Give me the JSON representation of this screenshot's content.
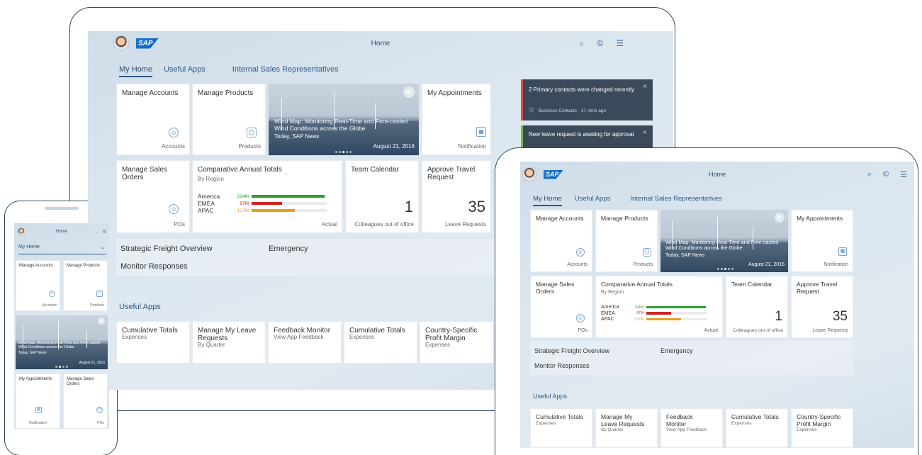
{
  "desktop": {
    "shell": {
      "title": "Home",
      "logo": "SAP",
      "icons": [
        "search-icon",
        "copilot-icon",
        "notifications-icon"
      ]
    },
    "tabs": [
      "My Home",
      "Useful Apps",
      "Internal Sales Representatives"
    ],
    "tiles": {
      "manage_accounts": {
        "title": "Manage Accounts",
        "icon": "accounts-icon",
        "footer": "Accounts"
      },
      "manage_products": {
        "title": "Manage Products",
        "icon": "products-icon",
        "footer": "Products"
      },
      "news": {
        "text": "Wind Map: Monitoring Real-Time and Fore-casted Wind Conditions across the Globe",
        "source": "Today, SAP News",
        "date": "August 21, 2016"
      },
      "my_appointments": {
        "title": "My Appointments",
        "icon": "calendar-icon",
        "footer": "Notification"
      },
      "manage_sales_orders": {
        "title": "Manage Sales Orders",
        "icon": "pos-icon",
        "footer": "POs"
      },
      "comparative": {
        "title": "Comparative Annual Totals",
        "subtitle": "By Region",
        "footer": "Actual",
        "bars": [
          {
            "label": "America",
            "value_label": "234M",
            "value": 234,
            "color": "#2ba02b"
          },
          {
            "label": "EMEA",
            "value_label": "97M",
            "value": 97,
            "color": "#cf2424"
          },
          {
            "label": "APAC",
            "value_label": "137M",
            "value": 137,
            "color": "#e5a021"
          }
        ],
        "max": 240
      },
      "team_calendar": {
        "title": "Team Calendar",
        "number": "1",
        "footer": "Colleagues out of office"
      },
      "approve_travel": {
        "title": "Approve Travel Request",
        "number": "35",
        "footer": "Leave Requests"
      }
    },
    "links": [
      "Strategic Freight Overview",
      "Emergency",
      "Monitor Responses"
    ],
    "useful_apps_title": "Useful Apps",
    "useful_apps": [
      {
        "title": "Cumulative Totals",
        "subtitle": "Expenses"
      },
      {
        "title": "Manage My Leave Requests",
        "subtitle": "By Quarter"
      },
      {
        "title": "Feedback Monitor",
        "subtitle": "View App Feedback"
      },
      {
        "title": "Cumulative Totals",
        "subtitle": "Expenses"
      },
      {
        "title": "Country-Specific Profit Margin",
        "subtitle": "Expenses"
      }
    ],
    "notifications": [
      {
        "text": "2 Primary contacts were changed recently",
        "meta": "Business Contacts · 17 mins ago",
        "priority_color": "#e24a4a"
      },
      {
        "text": "New leave request is awating for approval",
        "priority_color": "#6dbe4b"
      }
    ]
  },
  "phone": {
    "shell": {
      "title": "Home"
    },
    "tab_select": "My Home",
    "tiles": {
      "manage_accounts": {
        "title": "Manage Accounts",
        "footer": "Accounts"
      },
      "manage_products": {
        "title": "Manage Products",
        "footer": "Products"
      },
      "news": {
        "text": "Wind Map: Monitoring Real-Time and Fore-casted Wind Conditions across the Globe",
        "source": "Today, SAP News",
        "date": "August 21, 2016"
      },
      "my_appointments": {
        "title": "My Appointments",
        "footer": "Notification"
      },
      "manage_sales_orders": {
        "title": "Manage Sales Orders",
        "footer": "POs"
      }
    }
  }
}
